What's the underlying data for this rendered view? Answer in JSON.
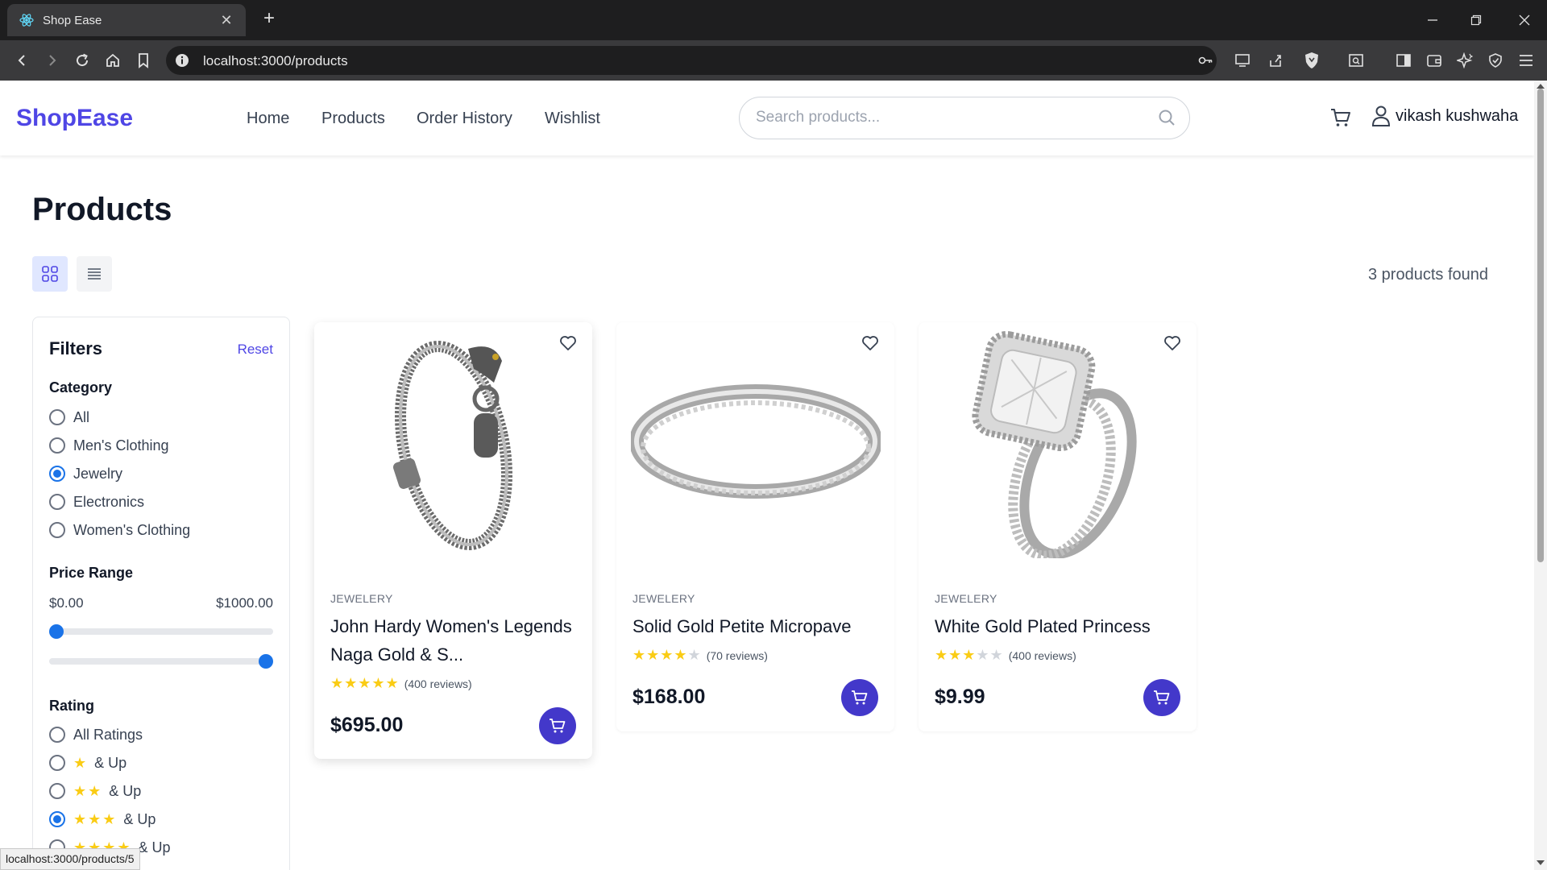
{
  "browser": {
    "tab_title": "Shop Ease",
    "url": "localhost:3000/products",
    "status_url": "localhost:3000/products/5"
  },
  "header": {
    "logo": "ShopEase",
    "nav": [
      "Home",
      "Products",
      "Order History",
      "Wishlist"
    ],
    "search_placeholder": "Search products...",
    "user_name": "vikash kushwaha"
  },
  "page": {
    "title": "Products",
    "products_found": "3 products found"
  },
  "filters": {
    "title": "Filters",
    "reset_label": "Reset",
    "category_label": "Category",
    "categories": [
      "All",
      "Men's Clothing",
      "Jewelry",
      "Electronics",
      "Women's Clothing"
    ],
    "selected_category": "Jewelry",
    "price_label": "Price Range",
    "price_min": "$0.00",
    "price_max": "$1000.00",
    "rating_label": "Rating",
    "rating_all": "All Ratings",
    "rating_suffix": "& Up",
    "rating_options_stars": [
      1,
      2,
      3,
      4
    ],
    "selected_rating_stars": 3
  },
  "products": [
    {
      "category": "JEWELERY",
      "name": "John Hardy Women's Legends Naga Gold & S...",
      "stars": 5,
      "reviews": "(400 reviews)",
      "price": "$695.00",
      "image": "chain-bracelet"
    },
    {
      "category": "JEWELERY",
      "name": "Solid Gold Petite Micropave",
      "stars": 4,
      "reviews": "(70 reviews)",
      "price": "$168.00",
      "image": "silver-band-ring"
    },
    {
      "category": "JEWELERY",
      "name": "White Gold Plated Princess",
      "stars": 3,
      "reviews": "(400 reviews)",
      "price": "$9.99",
      "image": "diamond-engagement-ring"
    }
  ],
  "colors": {
    "brand": "#4f46e5",
    "cart_button": "#4338ca",
    "radio_selected": "#1a73e8",
    "star": "#facc15"
  }
}
